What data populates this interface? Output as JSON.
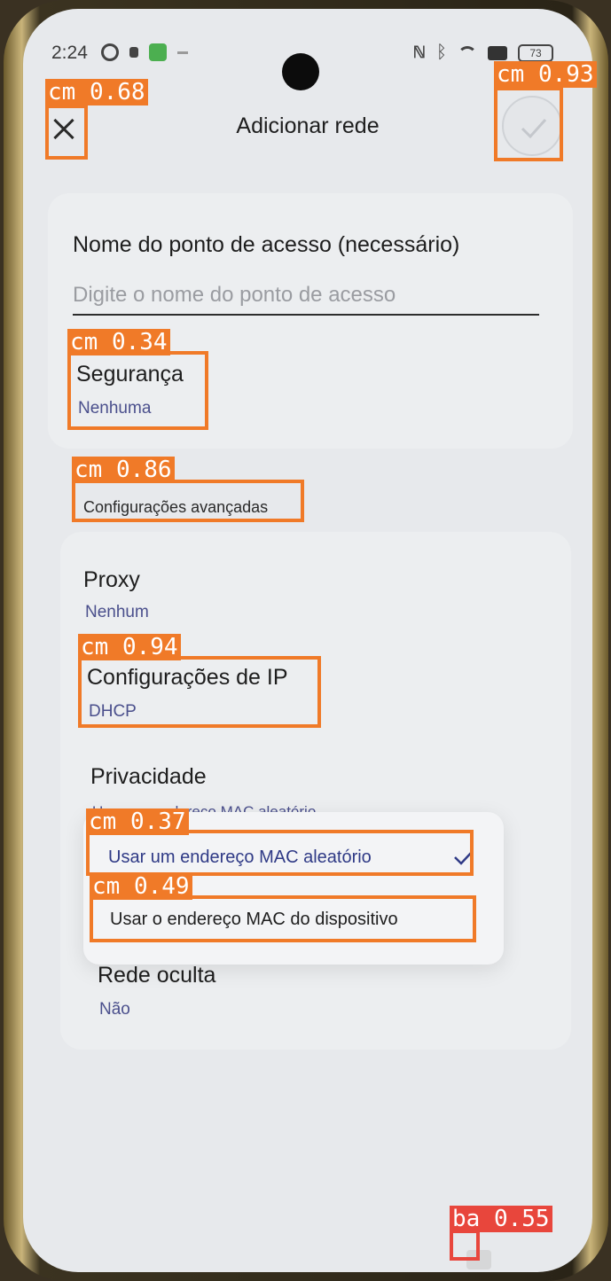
{
  "status_bar": {
    "time": "2:24",
    "battery": "73"
  },
  "header": {
    "title": "Adicionar rede"
  },
  "access_point": {
    "label": "Nome do ponto de acesso (necessário)",
    "placeholder": "Digite o nome do ponto de acesso"
  },
  "security": {
    "label": "Segurança",
    "value": "Nenhuma"
  },
  "advanced": {
    "label": "Configurações avançadas"
  },
  "proxy": {
    "label": "Proxy",
    "value": "Nenhum"
  },
  "ip": {
    "label": "Configurações de IP",
    "value": "DHCP"
  },
  "privacy": {
    "label": "Privacidade",
    "value": "Usar um endereço MAC aleatório",
    "options": [
      {
        "label": "Usar um endereço MAC aleatório",
        "selected": true
      },
      {
        "label": "Usar o endereço MAC do dispositivo",
        "selected": false
      }
    ]
  },
  "hidden_network": {
    "label": "Rede oculta",
    "value": "Não"
  },
  "detections": [
    {
      "label": "cm 0.68"
    },
    {
      "label": "cm 0.93"
    },
    {
      "label": "cm 0.34"
    },
    {
      "label": "cm 0.86"
    },
    {
      "label": "cm 0.94"
    },
    {
      "label": "cm 0.37"
    },
    {
      "label": "cm 0.49"
    },
    {
      "label": "ba 0.55"
    }
  ],
  "colors": {
    "accent": "#4a4f8c",
    "detection_box": "#f07a28",
    "detection_box_alt": "#e8463c"
  }
}
